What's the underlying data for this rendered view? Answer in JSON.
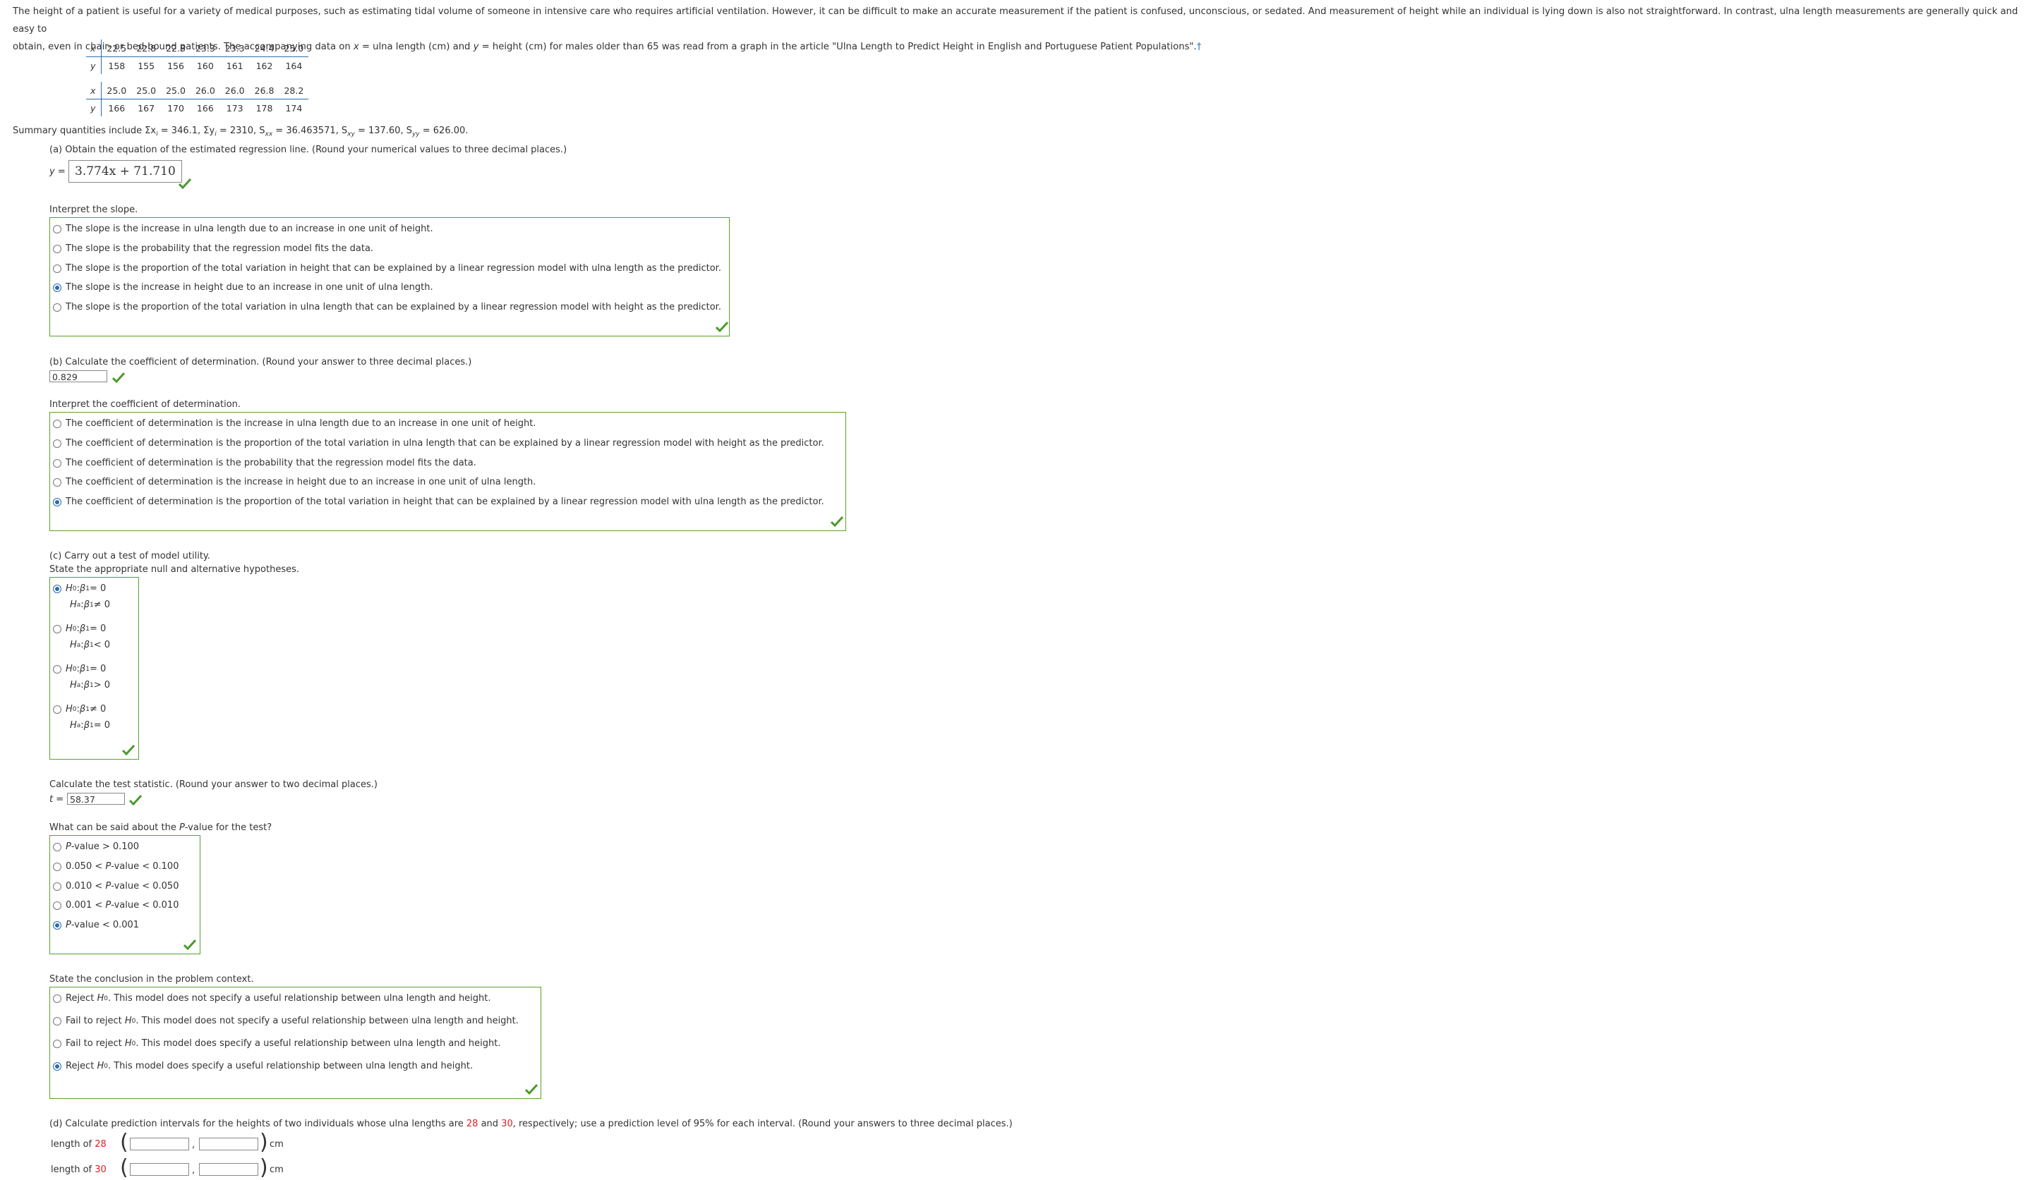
{
  "intro": {
    "line1": "The height of a patient is useful for a variety of medical purposes, such as estimating tidal volume of someone in intensive care who requires artificial ventilation. However, it can be difficult to make an accurate measurement if the patient is confused, unconscious, or sedated. And measurement of height while an individual is lying down is also not straightforward. In contrast, ulna length measurements are generally quick and easy to",
    "line2_a": "obtain, even in chair- or bed-bound patients. The accompanying data on ",
    "line2_b": " = ulna length (cm) and ",
    "line2_c": " = height (cm) for males older than 65 was read from a graph in the article \"Ulna Length to Predict Height in English and Portuguese Patient Populations\".",
    "dagger": "†"
  },
  "table1": {
    "x": [
      "22.5",
      "22.8",
      "22.8",
      "23.3",
      "23.3",
      "24.4",
      "25.0"
    ],
    "y": [
      "158",
      "155",
      "156",
      "160",
      "161",
      "162",
      "164"
    ]
  },
  "table2": {
    "x": [
      "25.0",
      "25.0",
      "25.0",
      "26.0",
      "26.0",
      "26.8",
      "28.2"
    ],
    "y": [
      "166",
      "167",
      "170",
      "166",
      "173",
      "178",
      "174"
    ]
  },
  "summary": "Summary quantities include Σx",
  "summary_vals": {
    "sx": "= 346.1, Σy",
    "sy": "= 2310, S",
    "sxx": "= 36.463571, S",
    "sxy": "= 137.60, S",
    "syy": "= 626.00."
  },
  "part_a": {
    "prompt": "(a) Obtain the equation of the estimated regression line. (Round your numerical values to three decimal places.)",
    "y_label": "y =",
    "answer": "3.774x + 71.710"
  },
  "slope": {
    "prompt": "Interpret the slope.",
    "options": [
      "The slope is the increase in ulna length due to an increase in one unit of height.",
      "The slope is the probability that the regression model fits the data.",
      "The slope is the proportion of the total variation in height that can be explained by a linear regression model with ulna length as the predictor.",
      "The slope is the increase in height due to an increase in one unit of ulna length.",
      "The slope is the proportion of the total variation in ulna length that can be explained by a linear regression model with height as the predictor."
    ],
    "selected": 3
  },
  "part_b": {
    "prompt": "(b) Calculate the coefficient of determination. (Round your answer to three decimal places.)",
    "answer": "0.829"
  },
  "cod": {
    "prompt": "Interpret the coefficient of determination.",
    "options": [
      "The coefficient of determination is the increase in ulna length due to an increase in one unit of height.",
      "The coefficient of determination is the proportion of the total variation in ulna length that can be explained by a linear regression model with height as the predictor.",
      "The coefficient of determination is the probability that the regression model fits the data.",
      "The coefficient of determination is the increase in height due to an increase in one unit of ulna length.",
      "The coefficient of determination is the proportion of the total variation in height that can be explained by a linear regression model with ulna length as the predictor."
    ],
    "selected": 4
  },
  "part_c": {
    "prompt": "(c) Carry out a test of model utility.",
    "prompt2": "State the appropriate null and alternative hypotheses.",
    "hyp": [
      {
        "h0": "= 0",
        "ha": "≠ 0"
      },
      {
        "h0": "= 0",
        "ha": "< 0"
      },
      {
        "h0": "= 0",
        "ha": "> 0"
      },
      {
        "h0": "≠ 0",
        "ha": "= 0"
      }
    ],
    "selected": 0,
    "h0_sym": "H",
    "beta": "β",
    "colon": ":"
  },
  "tstat": {
    "prompt": "Calculate the test statistic. (Round your answer to two decimal places.)",
    "label": "t =",
    "answer": "58.37"
  },
  "pvalue": {
    "prompt_a": "What can be said about the ",
    "prompt_p": "P",
    "prompt_b": "-value for the test?",
    "options": [
      {
        "pre": "",
        "p": "P",
        "post": "-value > 0.100"
      },
      {
        "pre": "0.050 < ",
        "p": "P",
        "post": "-value < 0.100"
      },
      {
        "pre": "0.010 < ",
        "p": "P",
        "post": "-value < 0.050"
      },
      {
        "pre": "0.001 < ",
        "p": "P",
        "post": "-value < 0.010"
      },
      {
        "pre": "",
        "p": "P",
        "post": "-value < 0.001"
      }
    ],
    "selected": 4
  },
  "conclusion": {
    "prompt": "State the conclusion in the problem context.",
    "options": [
      {
        "a": "Reject ",
        "b": ". This model does not specify a useful relationship between ulna length and height."
      },
      {
        "a": "Fail to reject ",
        "b": ". This model does not specify a useful relationship between ulna length and height."
      },
      {
        "a": "Fail to reject ",
        "b": ". This model does specify a useful relationship between ulna length and height."
      },
      {
        "a": "Reject ",
        "b": ". This model does specify a useful relationship between ulna length and height."
      }
    ],
    "selected": 3
  },
  "part_d": {
    "prompt_a": "(d) Calculate prediction intervals for the heights of two individuals whose ulna lengths are ",
    "v1": "28",
    "prompt_and": " and ",
    "v2": "30",
    "prompt_b": ", respectively; use a prediction level of 95% for each interval. (Round your answers to three decimal places.)",
    "row_label": "length of ",
    "comma": ",",
    "unit": "cm"
  },
  "colors": {
    "accent_blue": "#2b6cb0",
    "box_green": "#5aa02c",
    "check_green": "#4a9a2a",
    "highlight_red": "#dd2222"
  }
}
